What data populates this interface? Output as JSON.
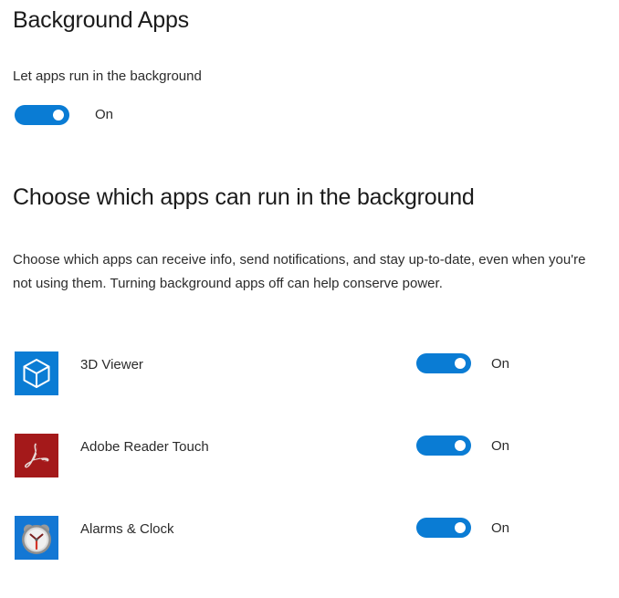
{
  "page": {
    "title": "Background Apps"
  },
  "master": {
    "label": "Let apps run in the background",
    "state": "On",
    "toggle_on": true
  },
  "section": {
    "heading": "Choose which apps can run in the background",
    "description": "Choose which apps can receive info, send notifications, and stay up-to-date, even when you're not using them. Turning background apps off can help conserve power."
  },
  "colors": {
    "accent": "#0a7cd4",
    "viewer_icon_bg": "#0a7cd4",
    "adobe_icon_bg": "#a4191a",
    "clock_icon_bg": "#1377d4",
    "text": "#2b2b2b",
    "heading": "#1b1b1b"
  },
  "apps": [
    {
      "name": "3D Viewer",
      "state": "On",
      "toggle_on": true,
      "icon": "cube-icon"
    },
    {
      "name": "Adobe Reader Touch",
      "state": "On",
      "toggle_on": true,
      "icon": "adobe-acrobat-icon"
    },
    {
      "name": "Alarms & Clock",
      "state": "On",
      "toggle_on": true,
      "icon": "alarm-clock-icon"
    }
  ]
}
